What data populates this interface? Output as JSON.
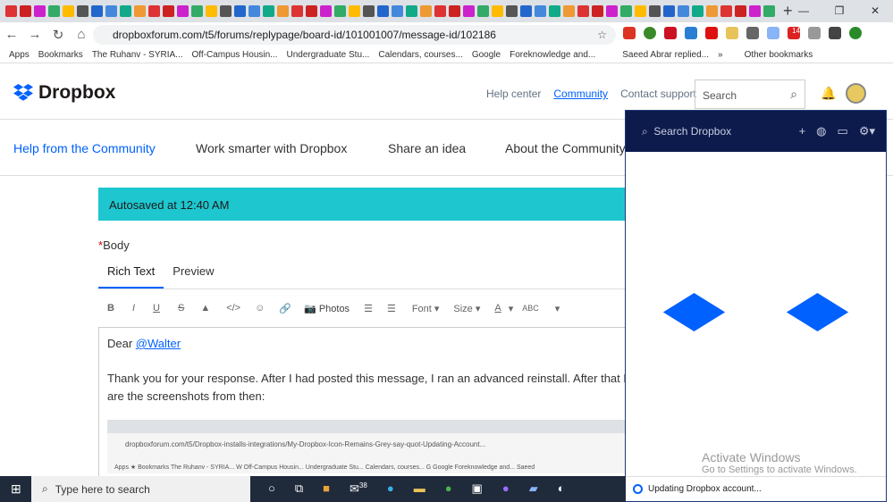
{
  "browser": {
    "url": "dropboxforum.com/t5/forums/replypage/board-id/101001007/message-id/102186",
    "new_tab": "+",
    "ext_badge": "14",
    "bookmarks": [
      "Apps",
      "Bookmarks",
      "The Ruhanv - SYRIA...",
      "Off-Campus Housin...",
      "Undergraduate Stu...",
      "Calendars, courses...",
      "Google",
      "Foreknowledge and...",
      "Saeed Abrar replied...",
      "»",
      "Other bookmarks"
    ]
  },
  "header": {
    "logo": "Dropbox",
    "links": [
      "Help center",
      "Community",
      "Contact support"
    ],
    "search_placeholder": "Search"
  },
  "menu": [
    "Help from the Community",
    "Work smarter with Dropbox",
    "Share an idea",
    "About the Community"
  ],
  "autosave": "Autosaved at 12:40 AM",
  "body_label": "Body",
  "required_mark": "*",
  "tabs": [
    "Rich Text",
    "Preview"
  ],
  "toolbar": {
    "bold": "B",
    "italic": "I",
    "underline": "U",
    "strike": "S",
    "photos": "Photos",
    "font": "Font ▾",
    "size": "Size ▾",
    "color": "A"
  },
  "editor": {
    "greeting": "Dear ",
    "mention": "@Walter",
    "paragraph": "Thank you for your response. After I had posted this message, I ran an advanced reinstall. After that Drop",
    "paragraph2": "are the screenshots from then:",
    "shot_url": "dropboxforum.com/t5/Dropbox-installs-integrations/My-Dropbox-Icon-Remains-Grey-say-quot-Updating-Account...",
    "shot_bookmarks": "Apps  ★ Bookmarks   The Ruhanv - SYRIA...  W Off-Campus Housin...   Undergraduate Stu...   Calendars, courses...  G Google   Foreknowledge and...   Saeed"
  },
  "panel": {
    "search": "Search Dropbox",
    "status": "Updating Dropbox account..."
  },
  "watermark": {
    "title": "Activate Windows",
    "sub": "Go to Settings to activate Windows."
  },
  "taskbar": {
    "search": "Type here to search",
    "mail_badge": "38"
  }
}
